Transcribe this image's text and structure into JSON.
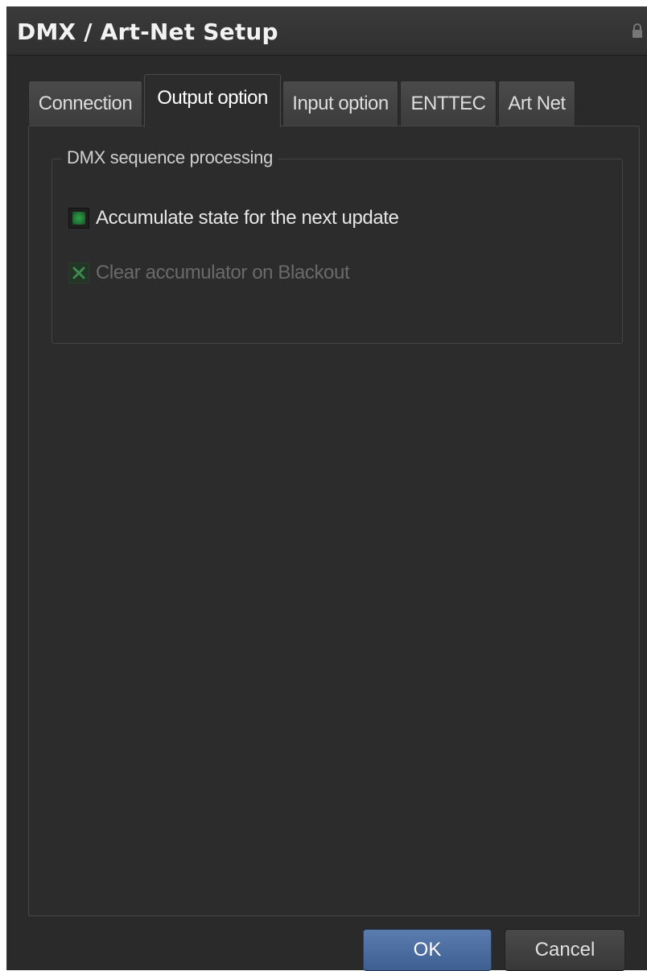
{
  "window": {
    "title": "DMX / Art-Net Setup"
  },
  "tabs": [
    {
      "label": "Connection",
      "active": false
    },
    {
      "label": "Output option",
      "active": true
    },
    {
      "label": "Input option",
      "active": false
    },
    {
      "label": "ENTTEC",
      "active": false
    },
    {
      "label": "Art Net",
      "active": false
    }
  ],
  "group": {
    "legend": "DMX sequence processing",
    "options": [
      {
        "label": "Accumulate state for the next update",
        "checked": true,
        "enabled": true
      },
      {
        "label": "Clear accumulator on Blackout",
        "checked": true,
        "enabled": false
      }
    ]
  },
  "footer": {
    "ok_label": "OK",
    "cancel_label": "Cancel"
  },
  "colors": {
    "background": "#2a2a2a",
    "accent": "#4a6ba0",
    "check_green": "#2fa14a"
  },
  "icons": {
    "title_right": "lock-icon",
    "checked_enabled": "checkbox-checked-icon",
    "checked_disabled": "checkbox-x-icon"
  }
}
